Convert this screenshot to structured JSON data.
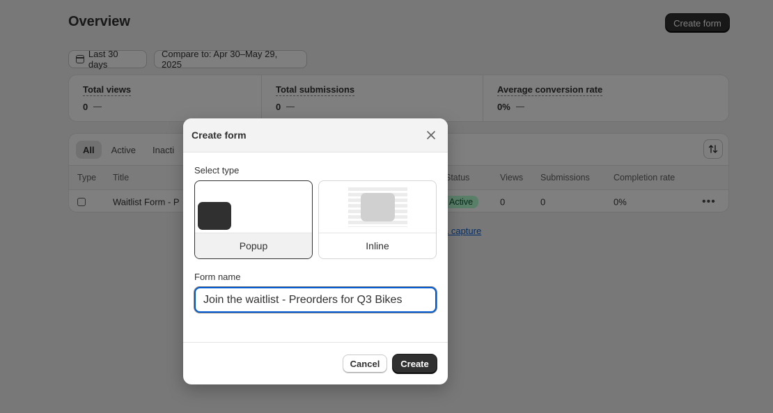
{
  "page": {
    "title": "Overview",
    "create_form_button": "Create form"
  },
  "filters": {
    "date_range": "Last 30 days",
    "compare": "Compare to: Apr 30–May 29, 2025"
  },
  "metrics": [
    {
      "label": "Total views",
      "value": "0"
    },
    {
      "label": "Total submissions",
      "value": "0"
    },
    {
      "label": "Average conversion rate",
      "value": "0%"
    }
  ],
  "table": {
    "tabs": [
      "All",
      "Active",
      "Inacti"
    ],
    "columns": {
      "type": "Type",
      "title": "Title",
      "status": "Status",
      "views": "Views",
      "submissions": "Submissions",
      "completion_rate": "Completion rate"
    },
    "rows": [
      {
        "title": "Waitlist Form - P",
        "status": "Active",
        "views": "0",
        "submissions": "0",
        "completion_rate": "0%"
      }
    ],
    "footer_link": "a capture"
  },
  "modal": {
    "title": "Create form",
    "select_type_label": "Select type",
    "types": [
      {
        "label": "Popup",
        "selected": true
      },
      {
        "label": "Inline",
        "selected": false
      }
    ],
    "form_name_label": "Form name",
    "form_name_value": "Join the waitlist - Preorders for Q3 Bikes",
    "cancel_label": "Cancel",
    "create_label": "Create"
  },
  "icons": {
    "calendar": "calendar-icon",
    "sort": "sort-icon",
    "close": "close-icon",
    "more": "more-horizontal-icon",
    "form_type": "popup-form-icon"
  },
  "colors": {
    "primary_button": "#303030",
    "focus_ring": "#005bd3",
    "active_badge_bg": "#b4fed2",
    "backdrop": "rgba(0,0,0,0.5)"
  }
}
